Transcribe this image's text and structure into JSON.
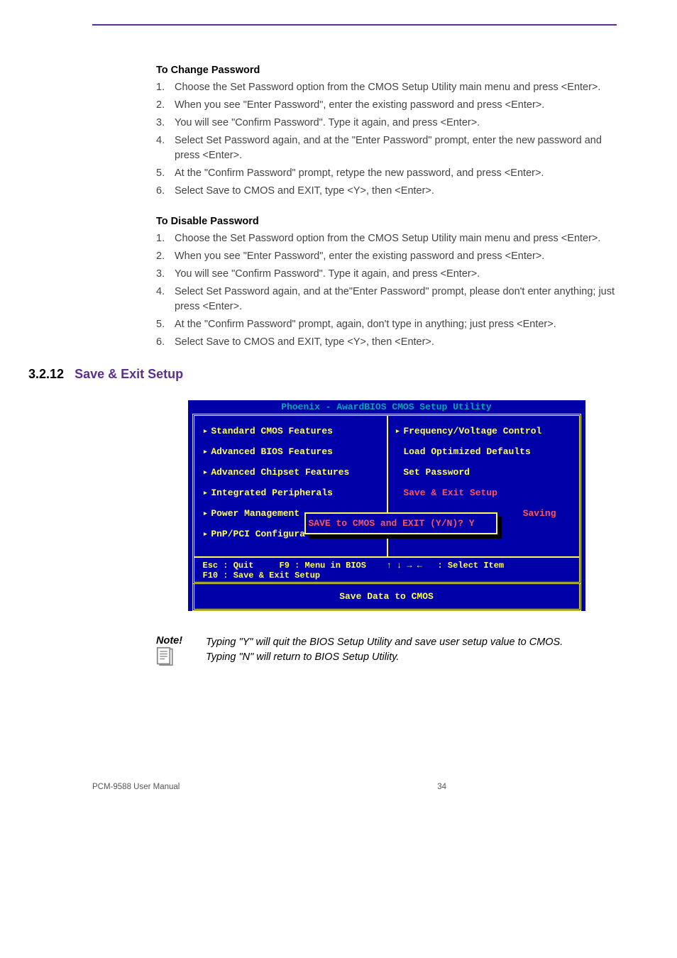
{
  "section1": {
    "heading": "To Change Password",
    "items": [
      "Choose the Set Password option from the CMOS Setup Utility main menu and press <Enter>.",
      "When you see \"Enter Password\", enter the existing password and press <Enter>.",
      "You will see \"Confirm Password\". Type it again, and press <Enter>.",
      "Select Set Password again, and at the \"Enter Password\" prompt, enter the new password and press <Enter>.",
      "At the \"Confirm Password\" prompt, retype the new password, and press <Enter>.",
      "Select Save to CMOS and EXIT, type <Y>, then <Enter>."
    ]
  },
  "section2": {
    "heading": "To Disable Password",
    "items": [
      "Choose the Set Password option from the CMOS Setup Utility main menu and press <Enter>.",
      "When you see \"Enter Password\", enter the existing password and press <Enter>.",
      "You will see \"Confirm Password\". Type it again, and press <Enter>.",
      "Select Set Password again, and at the\"Enter Password\" prompt, please don't enter anything; just press <Enter>.",
      "At the \"Confirm Password\" prompt, again, don't type in anything; just press <Enter>.",
      "Select Save to CMOS and EXIT, type <Y>, then <Enter>."
    ]
  },
  "h2": {
    "num": "3.2.12",
    "title": "Save & Exit Setup"
  },
  "bios": {
    "title": "Phoenix - AwardBIOS CMOS Setup Utility",
    "left": [
      {
        "arrow": true,
        "text": "Standard CMOS Features",
        "hl": false
      },
      {
        "arrow": true,
        "text": "Advanced BIOS Features",
        "hl": false
      },
      {
        "arrow": true,
        "text": "Advanced Chipset Features",
        "hl": false
      },
      {
        "arrow": true,
        "text": "Integrated Peripherals",
        "hl": false
      },
      {
        "arrow": true,
        "text": "Power Management",
        "hl": false
      },
      {
        "arrow": true,
        "text": "PnP/PCI Configura",
        "hl": false
      }
    ],
    "right": [
      {
        "arrow": true,
        "text": "Frequency/Voltage Control",
        "hl": false
      },
      {
        "arrow": false,
        "text": "Load Optimized Defaults",
        "hl": false
      },
      {
        "arrow": false,
        "text": "Set Password",
        "hl": false
      },
      {
        "arrow": false,
        "text": "Save & Exit Setup",
        "hl": true
      },
      {
        "arrow": false,
        "text": "Saving",
        "hl": true,
        "indent": true
      }
    ],
    "dialog": "SAVE to CMOS and EXIT (Y/N)? Y",
    "legend_left_1": "Esc : Quit",
    "legend_left_2": "F9 : Menu in BIOS",
    "legend_left_3": "F10 : Save & Exit Setup",
    "legend_right": "↑ ↓ → ←   : Select Item",
    "footer": "Save Data to CMOS"
  },
  "note": {
    "label": "Note!",
    "line1": "Typing \"Y\" will quit the BIOS Setup Utility and save user setup value to CMOS.",
    "line2": "Typing \"N\" will return to BIOS Setup Utility."
  },
  "footer": {
    "left": "PCM-9588 User Manual",
    "page": "34"
  }
}
